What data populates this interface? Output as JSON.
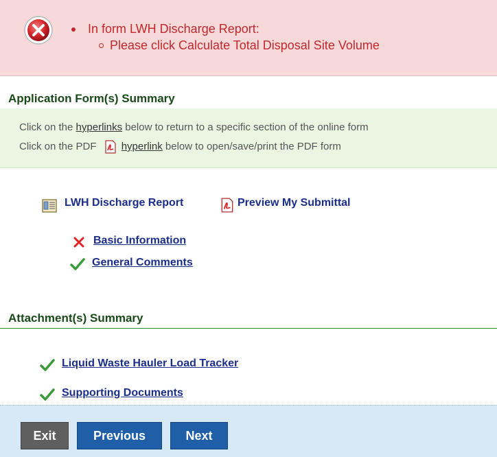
{
  "error": {
    "line1": "In form LWH Discharge Report:",
    "line2": "Please click Calculate Total Disposal Site Volume"
  },
  "app_summary": {
    "title": "Application Form(s) Summary",
    "info_line1_prefix": "Click on the ",
    "info_line1_link": "hyperlinks",
    "info_line1_suffix": " below to return to a specific section of the online form",
    "info_line2_prefix": "Click on the PDF",
    "info_line2_link": "hyperlink",
    "info_line2_suffix": " below to open/save/print the PDF form"
  },
  "form": {
    "name": "LWH Discharge Report",
    "preview_label": "Preview My Submittal",
    "sections": [
      {
        "label": "Basic Information",
        "status": "error"
      },
      {
        "label": "General Comments",
        "status": "complete"
      }
    ]
  },
  "attachments": {
    "title": "Attachment(s) Summary",
    "items": [
      {
        "label": "Liquid Waste Hauler Load Tracker",
        "status": "complete"
      },
      {
        "label": "Supporting Documents",
        "status": "complete"
      }
    ]
  },
  "buttons": {
    "exit": "Exit",
    "previous": "Previous",
    "next": "Next"
  },
  "colors": {
    "error_bg": "#f7d9d9",
    "error_text": "#c0282d",
    "section_rule": "#2e8b3a",
    "link": "#1a2e8a",
    "footer_bg": "#d7e8f6",
    "button_blue": "#1f5fa8",
    "button_gray": "#5f5f5f"
  }
}
